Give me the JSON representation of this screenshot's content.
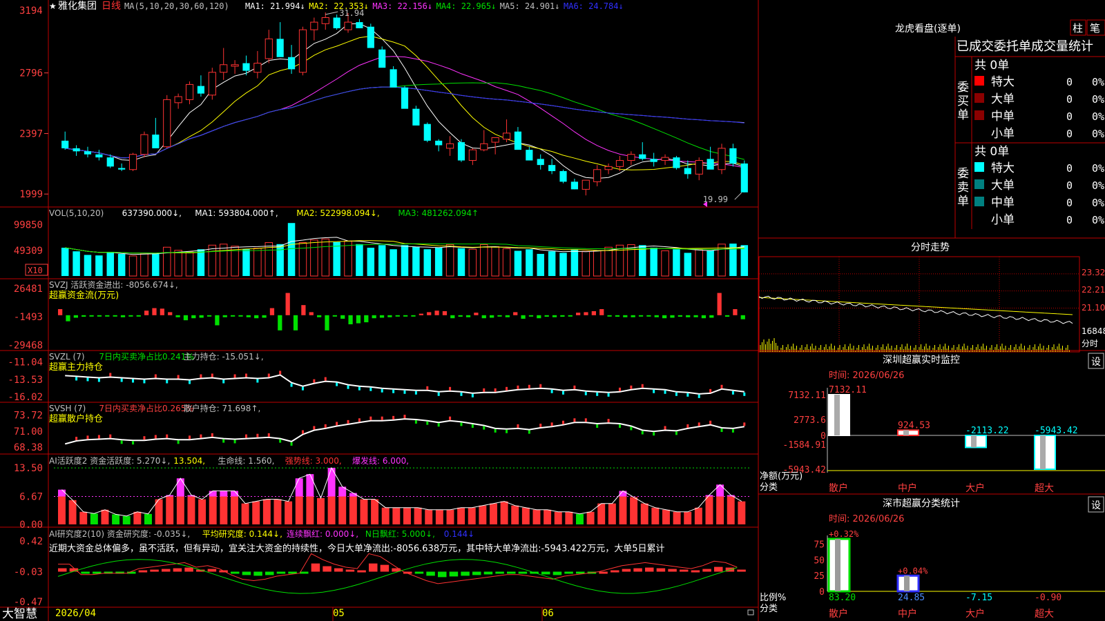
{
  "colors": {
    "up": "#ff3333",
    "down": "#00ffff",
    "green": "#00e000",
    "magenta": "#ff33ff",
    "yellow": "#ffff00",
    "white": "#ffffff",
    "blue": "#3030ff",
    "grid_red": "#c00000",
    "label_red": "#ff4040",
    "label_gray": "#c0c0c0",
    "dark_red": "#8b0000",
    "teal": "#008080"
  },
  "header": {
    "star": "★",
    "stock_name": "雅化集团",
    "period": "日线",
    "ma_spec": "MA(5,10,20,30,60,120)",
    "ma_values": [
      {
        "label": "MA1: 21.994↓",
        "color": "#ffffff"
      },
      {
        "label": "MA2: 22.353↓",
        "color": "#ffff00"
      },
      {
        "label": "MA3: 22.156↓",
        "color": "#ff33ff"
      },
      {
        "label": "MA4: 22.965↓",
        "color": "#00e000"
      },
      {
        "label": "MA5: 24.901↓",
        "color": "#c0c0c0"
      },
      {
        "label": "MA6: 24.784↓",
        "color": "#3030ff"
      }
    ],
    "high_marker": "31.94",
    "low_marker": "19.99",
    "top_axis_label": "3194"
  },
  "chart_data": [
    {
      "type": "candlestick",
      "title": "雅化集团 日线",
      "y_ticks": [
        "3194",
        "2796",
        "2397",
        "1999"
      ],
      "ylim": [
        19.5,
        31.94
      ],
      "x_labels": [
        "2026/04",
        "05",
        "06"
      ],
      "candles": [
        [
          23.5,
          24.1,
          22.9,
          23.0
        ],
        [
          23.0,
          23.2,
          22.5,
          22.8
        ],
        [
          22.8,
          23.1,
          22.4,
          22.6
        ],
        [
          22.6,
          22.9,
          22.2,
          22.4
        ],
        [
          22.4,
          22.6,
          21.7,
          21.8
        ],
        [
          21.7,
          22.0,
          21.5,
          21.6
        ],
        [
          21.6,
          22.7,
          21.5,
          22.6
        ],
        [
          22.6,
          24.1,
          22.4,
          23.9
        ],
        [
          23.9,
          25.0,
          23.4,
          23.0
        ],
        [
          23.1,
          26.5,
          23.0,
          26.2
        ],
        [
          26.0,
          26.6,
          25.6,
          26.4
        ],
        [
          26.2,
          27.4,
          25.9,
          27.2
        ],
        [
          27.1,
          27.8,
          26.4,
          26.6
        ],
        [
          26.5,
          28.3,
          26.2,
          28.0
        ],
        [
          28.0,
          29.6,
          27.5,
          28.5
        ],
        [
          28.4,
          28.8,
          27.9,
          28.5
        ],
        [
          28.6,
          29.1,
          27.8,
          28.1
        ],
        [
          28.0,
          29.4,
          27.6,
          28.6
        ],
        [
          28.9,
          30.8,
          28.6,
          30.2
        ],
        [
          30.2,
          31.3,
          29.1,
          29.0
        ],
        [
          29.0,
          29.8,
          27.9,
          28.2
        ],
        [
          28.0,
          31.0,
          27.8,
          30.8
        ],
        [
          30.8,
          31.6,
          30.1,
          31.3
        ],
        [
          31.2,
          31.94,
          30.8,
          31.6
        ],
        [
          31.6,
          31.8,
          30.8,
          30.9
        ],
        [
          30.8,
          31.9,
          30.6,
          31.3
        ],
        [
          31.3,
          31.5,
          30.9,
          30.9
        ],
        [
          31.0,
          31.2,
          29.7,
          29.6
        ],
        [
          29.5,
          29.7,
          28.5,
          28.3
        ],
        [
          28.2,
          28.4,
          27.8,
          27.0
        ],
        [
          27.0,
          27.1,
          26.1,
          25.6
        ],
        [
          25.6,
          25.8,
          24.7,
          24.5
        ],
        [
          24.6,
          24.7,
          23.4,
          23.5
        ],
        [
          23.5,
          23.6,
          22.8,
          23.2
        ],
        [
          23.0,
          23.8,
          22.5,
          23.3
        ],
        [
          23.4,
          23.6,
          22.1,
          22.2
        ],
        [
          22.2,
          23.0,
          21.9,
          22.9
        ],
        [
          22.9,
          24.2,
          22.8,
          23.3
        ],
        [
          23.4,
          23.7,
          22.6,
          23.7
        ],
        [
          23.6,
          24.9,
          23.4,
          24.0
        ],
        [
          24.1,
          24.4,
          23.3,
          22.9
        ],
        [
          22.9,
          23.1,
          22.2,
          22.2
        ],
        [
          22.3,
          22.6,
          21.6,
          21.9
        ],
        [
          21.9,
          22.3,
          21.3,
          21.5
        ],
        [
          21.5,
          21.6,
          20.7,
          20.8
        ],
        [
          20.8,
          21.0,
          20.3,
          20.3
        ],
        [
          20.3,
          20.9,
          19.9,
          20.9
        ],
        [
          20.8,
          21.9,
          20.5,
          21.6
        ],
        [
          21.6,
          22.0,
          21.3,
          21.8
        ],
        [
          21.8,
          22.5,
          21.5,
          22.2
        ],
        [
          22.2,
          22.8,
          21.9,
          22.6
        ],
        [
          22.6,
          23.4,
          22.2,
          22.3
        ],
        [
          22.3,
          22.7,
          21.8,
          22.1
        ],
        [
          22.2,
          22.6,
          21.9,
          22.4
        ],
        [
          22.4,
          22.5,
          21.6,
          21.7
        ],
        [
          21.7,
          22.2,
          21.0,
          21.3
        ],
        [
          21.3,
          22.4,
          20.9,
          22.2
        ],
        [
          22.3,
          23.1,
          21.7,
          21.6
        ],
        [
          21.6,
          23.3,
          21.3,
          23.0
        ],
        [
          23.0,
          23.3,
          21.8,
          22.0
        ],
        [
          22.0,
          22.2,
          20.1,
          20.1
        ]
      ],
      "ma_series": [
        {
          "name": "MA1",
          "color": "#ffffff"
        },
        {
          "name": "MA2",
          "color": "#ffff00"
        },
        {
          "name": "MA3",
          "color": "#ff33ff"
        },
        {
          "name": "MA4",
          "color": "#00e000"
        },
        {
          "name": "MA5",
          "color": "#c0c0c0"
        },
        {
          "name": "MA6",
          "color": "#3030ff"
        }
      ]
    },
    {
      "type": "bar",
      "title": "VOL(5,10,20)",
      "header_values": [
        {
          "label": "VOL(5,10,20)",
          "color": "#c0c0c0"
        },
        {
          "label": "637390.000↓,",
          "color": "#ffffff"
        },
        {
          "label": "MA1: 593804.000↑,",
          "color": "#ffffff"
        },
        {
          "label": "MA2: 522998.094↓,",
          "color": "#ffff00"
        },
        {
          "label": "MA3: 481262.094↑",
          "color": "#00e000"
        }
      ],
      "y_ticks": [
        "99850",
        "49309"
      ],
      "unit_label": "X10",
      "ylim": [
        0,
        110000
      ],
      "values": [
        55000,
        48000,
        41000,
        40000,
        47000,
        43000,
        39000,
        44000,
        43000,
        56000,
        50000,
        47000,
        52000,
        60000,
        62000,
        58000,
        52000,
        54000,
        65000,
        62000,
        103000,
        65000,
        70000,
        72000,
        66000,
        68000,
        62000,
        55000,
        60000,
        52000,
        60000,
        57000,
        52000,
        55000,
        61000,
        54000,
        52000,
        61000,
        57000,
        53000,
        49000,
        52000,
        43000,
        48000,
        45000,
        52000,
        48000,
        49000,
        56000,
        60000,
        61000,
        60000,
        55000,
        49000,
        52000,
        45000,
        51000,
        50000,
        62000,
        63000,
        60000
      ]
    },
    {
      "type": "bar",
      "title": "SVZJ 活跃资金进出",
      "header_values": [
        {
          "label": "SVZJ  活跃资金进出: -8056.674↓,",
          "color": "#c0c0c0"
        }
      ],
      "sub_title": "超赢资金流(万元)",
      "y_ticks": [
        "26481",
        "-1493",
        "-29468"
      ],
      "ylim": [
        -29468,
        26481
      ],
      "values": [
        6000,
        -6000,
        -2500,
        -1500,
        -1000,
        -1000,
        -1000,
        -1000,
        -2000,
        -1000,
        -1000,
        4500,
        7000,
        6500,
        3000,
        -2000,
        -5000,
        -3000,
        -2500,
        -1000,
        -10000,
        -2000,
        -1000,
        -1000,
        -2000,
        -3000,
        -2500,
        7000,
        -15000,
        22000,
        -15000,
        10000,
        3000,
        -2000,
        -15000,
        -1000,
        -3500,
        -9000,
        -8000,
        -7000,
        -3000,
        -2500,
        -2000,
        -1000,
        -1000,
        -1000,
        1500,
        3000,
        4500,
        4000,
        -3000,
        -1500,
        -2000,
        2500,
        -3000,
        -2500,
        -1000,
        -2000,
        3000,
        -3500,
        -1000,
        -3000,
        -1500,
        -2000,
        -1500,
        -1000,
        2500,
        3000,
        4000,
        6000,
        -1000,
        -1500,
        -2000,
        -2000,
        -1000,
        -1000,
        -2000,
        -3000,
        -2500,
        -1500,
        -2000,
        -2000,
        -3000,
        -2500,
        22000,
        -1500,
        6000,
        -4000
      ]
    },
    {
      "type": "line",
      "title": "SVZL (7)",
      "header_values": [
        {
          "label": "SVZL (7)",
          "color": "#c0c0c0"
        },
        {
          "label": "7日内买卖净占比0.241%",
          "color": "#00e000"
        },
        {
          "label": "主力持仓: -15.051↓,",
          "color": "#c0c0c0"
        }
      ],
      "sub_title": "超赢主力持仓",
      "y_ticks": [
        "-11.04",
        "-13.53",
        "-16.02"
      ],
      "ylim": [
        -16.3,
        -10.6
      ],
      "values": [
        -13.0,
        -13.1,
        -13.2,
        -13.3,
        -13.2,
        -13.3,
        -13.4,
        -13.5,
        -13.4,
        -13.5,
        -13.5,
        -13.6,
        -13.4,
        -13.3,
        -13.5,
        -13.4,
        -13.3,
        -13.4,
        -13.3,
        -12.9,
        -14.0,
        -14.5,
        -14.1,
        -13.8,
        -13.9,
        -14.3,
        -14.5,
        -14.6,
        -14.8,
        -14.9,
        -15.0,
        -15.1,
        -15.1,
        -15.3,
        -15.2,
        -15.3,
        -15.5,
        -15.4,
        -15.4,
        -15.2,
        -15.0,
        -14.9,
        -14.8,
        -14.9,
        -15.1,
        -15.0,
        -15.2,
        -15.3,
        -15.4,
        -15.3,
        -15.0,
        -14.8,
        -14.9,
        -15.0,
        -15.3,
        -15.4,
        -15.6,
        -15.5,
        -14.9,
        -15.1,
        -15.3
      ]
    },
    {
      "type": "line",
      "title": "SVSH (7)",
      "header_values": [
        {
          "label": "SVSH (7)",
          "color": "#c0c0c0"
        },
        {
          "label": "7日内买卖净占比0.265%",
          "color": "#ff4040"
        },
        {
          "label": "散户持仓: 71.698↑,",
          "color": "#c0c0c0"
        }
      ],
      "sub_title": "超赢散户持仓",
      "y_ticks": [
        "73.72",
        "71.00",
        "68.38"
      ],
      "ylim": [
        67.9,
        74.5
      ],
      "values": [
        68.9,
        69.4,
        69.6,
        69.7,
        69.8,
        69.6,
        69.5,
        69.5,
        69.7,
        69.8,
        69.6,
        69.6,
        69.8,
        70.0,
        69.8,
        69.7,
        69.8,
        69.9,
        70.0,
        69.8,
        69.3,
        70.5,
        71.2,
        71.5,
        71.9,
        72.2,
        72.5,
        72.8,
        72.8,
        72.9,
        73.1,
        73.0,
        72.8,
        72.5,
        72.8,
        72.6,
        72.3,
        72.0,
        71.5,
        71.4,
        71.5,
        71.3,
        71.6,
        71.8,
        72.1,
        72.5,
        72.5,
        72.3,
        72.4,
        72.3,
        71.9,
        71.2,
        71.0,
        71.2,
        71.1,
        71.5,
        71.8,
        72.1,
        71.6,
        71.5,
        71.8
      ]
    },
    {
      "type": "bar",
      "title": "AI活跃度2",
      "header_values": [
        {
          "label": "AI活跃度2 资金活跃度: 5.270↓,",
          "color": "#c0c0c0"
        },
        {
          "label": "13.504,",
          "color": "#ffff00"
        },
        {
          "label": "生命线: 1.560,",
          "color": "#c0c0c0"
        },
        {
          "label": "强势线: 3.000,",
          "color": "#ff3333"
        },
        {
          "label": "爆发线: 6.000,",
          "color": "#ff33ff"
        }
      ],
      "y_ticks": [
        "13.50",
        "6.67",
        "0.00"
      ],
      "ylim": [
        0,
        14.5
      ],
      "values": [
        8.3,
        5.8,
        3.0,
        2.6,
        3.5,
        2.4,
        2.0,
        3.0,
        2.5,
        6.0,
        7.0,
        11.0,
        7.0,
        6.0,
        8.0,
        8.0,
        8.0,
        5.0,
        5.5,
        6.0,
        6.0,
        5.5,
        11.0,
        12.0,
        6.3,
        13.5,
        9.0,
        7.5,
        6.0,
        6.0,
        4.0,
        4.0,
        4.0,
        4.0,
        3.5,
        3.5,
        3.5,
        4.0,
        4.0,
        4.5,
        5.0,
        5.5,
        4.5,
        4.0,
        3.5,
        3.5,
        3.0,
        3.0,
        2.5,
        3.0,
        5.0,
        5.0,
        8.0,
        6.5,
        5.0,
        4.0,
        3.5,
        3.0,
        3.0,
        4.0,
        7.0,
        9.5,
        7.0,
        5.5
      ]
    },
    {
      "type": "bar",
      "title": "AI研究度2(10)",
      "header_values": [
        {
          "label": "AI研究度2(10) 资金研究度: -0.035↓,",
          "color": "#c0c0c0"
        },
        {
          "label": "平均研究度: 0.144↓,",
          "color": "#ffff00"
        },
        {
          "label": "连续飘红: 0.000↓,",
          "color": "#ff33ff"
        },
        {
          "label": "N日飘红: 5.000↓,",
          "color": "#00e000"
        },
        {
          "label": "0.144↓",
          "color": "#3030ff"
        }
      ],
      "sentence": "近期大资金总体偏多，虽不活跃，但有异动，宜关注大资金的持续性，今日大单净流出:-8056.638万元，其中特大单净流出:-5943.422万元，大单5日累计",
      "y_ticks": [
        "0.42",
        "-0.03",
        "-0.47"
      ],
      "ylim": [
        -0.47,
        0.42
      ],
      "values": [
        0.05,
        0.05,
        -0.02,
        -0.02,
        -0.01,
        -0.01,
        -0.01,
        0.02,
        0.03,
        0.04,
        0.05,
        0.06,
        0.03,
        0.04,
        0.02,
        -0.02,
        -0.05,
        -0.06,
        -0.05,
        -0.03,
        -0.02,
        -0.01,
        0.12,
        0.08,
        0.05,
        0.03,
        0.02,
        0.12,
        0.1,
        0.05,
        0.0,
        -0.03,
        -0.06,
        -0.08,
        -0.07,
        -0.06,
        -0.05,
        -0.04,
        -0.03,
        -0.02,
        -0.02,
        -0.03,
        -0.04,
        -0.05,
        -0.03,
        -0.02,
        -0.01,
        0.0,
        0.02,
        0.04,
        0.05,
        0.06,
        0.05,
        0.04,
        0.03,
        0.02,
        0.04,
        0.07,
        0.06,
        0.03
      ]
    },
    {
      "type": "bar",
      "title": "深圳超赢实时监控",
      "time_label": "时间: 2026/06/26",
      "y_ticks": [
        "7132.11",
        "2773.6",
        "0",
        "-1584.91",
        "-5943.42"
      ],
      "ylabel": "净额(万元)",
      "xlabel": "分类",
      "categories": [
        "散户",
        "中户",
        "大户",
        "超大"
      ],
      "values": [
        7132.11,
        924.53,
        -2113.22,
        -5943.42
      ],
      "labels": [
        "7132.11",
        "924.53",
        "-2113.22",
        "-5943.42"
      ]
    },
    {
      "type": "bar",
      "title": "深市超赢分类统计",
      "time_label": "时间: 2026/06/26",
      "y_ticks": [
        "75",
        "50",
        "25",
        "0"
      ],
      "ylabel": "比例%",
      "xlabel": "分类",
      "categories": [
        "散户",
        "中户",
        "大户",
        "超大"
      ],
      "values": [
        83.2,
        24.85,
        -7.15,
        -0.9
      ],
      "top_labels": [
        "+0.32%",
        "+0.04%",
        "",
        ""
      ],
      "bottom_labels": [
        "83.20",
        "24.85",
        "-7.15",
        "-0.90"
      ]
    }
  ],
  "right_panel": {
    "dragon_title": "龙虎看盘(逐单)",
    "btn_zhu": "柱",
    "btn_bi": "笔",
    "table_title": "已成交委托单成交量统计",
    "buy_label": "委买单",
    "sell_label": "委卖单",
    "buy_total": "共 0单",
    "sell_total": "共 0单",
    "buy_rows": [
      {
        "name": "特大",
        "count": "0",
        "pct": "0%",
        "color": "#ff0000"
      },
      {
        "name": "大单",
        "count": "0",
        "pct": "0%",
        "color": "#8b0000"
      },
      {
        "name": "中单",
        "count": "0",
        "pct": "0%",
        "color": "#8b0000"
      },
      {
        "name": "小单",
        "count": "0",
        "pct": "0%",
        "color": ""
      }
    ],
    "sell_rows": [
      {
        "name": "特大",
        "count": "0",
        "pct": "0%",
        "color": "#00ffff"
      },
      {
        "name": "大单",
        "count": "0",
        "pct": "0%",
        "color": "#008080"
      },
      {
        "name": "中单",
        "count": "0",
        "pct": "0%",
        "color": "#008080"
      },
      {
        "name": "小单",
        "count": "0",
        "pct": "0%",
        "color": ""
      }
    ],
    "intraday_title": "分时走势",
    "intraday_ticks": [
      "23.32",
      "22.21",
      "21.10",
      "16848",
      "分时"
    ],
    "sz_settings": "设",
    "ss_settings": "设"
  },
  "footer": {
    "app_name": "大智慧",
    "date_start": "2026/04"
  }
}
